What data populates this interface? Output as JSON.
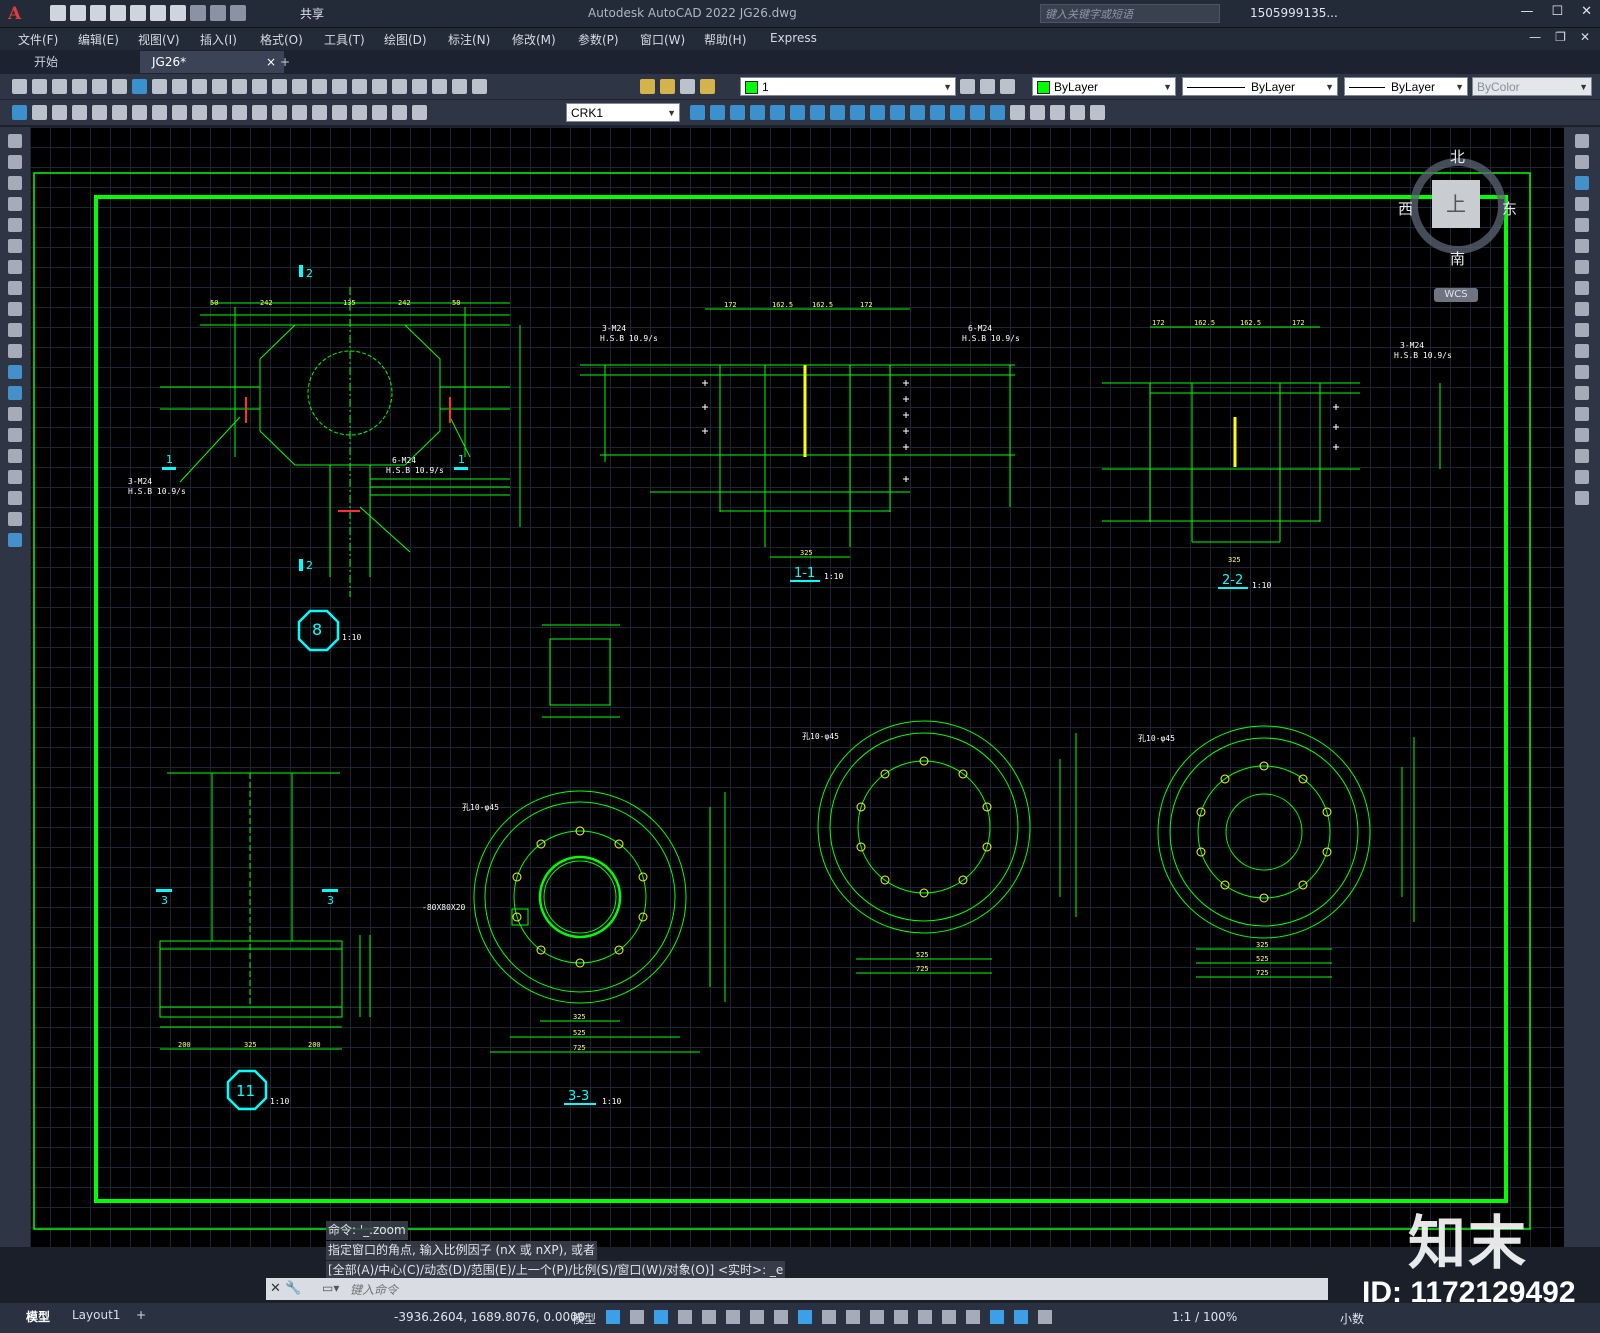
{
  "titlebar": {
    "app_icon": "A",
    "share_label": "共享",
    "title": "Autodesk AutoCAD 2022    JG26.dwg",
    "search_placeholder": "键入关键字或短语",
    "user_label": "1505999135...",
    "icons": [
      "new-icon",
      "open-icon",
      "save-icon",
      "saveas-icon",
      "plot-icon",
      "undo-icon",
      "redo-icon",
      "cart-icon",
      "help-icon"
    ]
  },
  "menu": {
    "items": [
      "文件(F)",
      "编辑(E)",
      "视图(V)",
      "插入(I)",
      "格式(O)",
      "工具(T)",
      "绘图(D)",
      "标注(N)",
      "修改(M)",
      "参数(P)",
      "窗口(W)",
      "帮助(H)",
      "Express"
    ]
  },
  "tabs": {
    "start": "开始",
    "file": "JG26*",
    "close_glyph": "×",
    "add_glyph": "+"
  },
  "toolbar": {
    "layer_value": "1",
    "color_value": "ByLayer",
    "linetype_value": "ByLayer",
    "lineweight_value": "ByLayer",
    "plotstyle_value": "ByColor",
    "dimstyle_value": "CRK1"
  },
  "viewcube": {
    "north": "北",
    "south": "南",
    "east": "东",
    "west": "西",
    "face": "上",
    "ucs_label": "WCS"
  },
  "drawing": {
    "callouts": [
      {
        "label": "8",
        "scale": "1:10"
      },
      {
        "label": "11",
        "scale": "1:10"
      }
    ],
    "sections": [
      {
        "label": "1-1",
        "scale": "1:10"
      },
      {
        "label": "2-2",
        "scale": "1:10"
      },
      {
        "label": "3-3",
        "scale": "1:10"
      }
    ],
    "bolt_notes": [
      "3-M24",
      "H.S.B 10.9/s",
      "6-M24",
      "H.S.B 10.9/s"
    ],
    "plate_note": "-80X80X20",
    "hole_notes": [
      "孔10-φ45",
      "孔10-φ45",
      "孔10-φ45"
    ],
    "dims_top": [
      "50",
      "242",
      "135",
      "242",
      "50"
    ],
    "dims_section": [
      "172",
      "162.5",
      "162.5",
      "172"
    ],
    "dims_bottom": [
      "325",
      "525",
      "725"
    ],
    "base_dims": [
      "200",
      "325",
      "200"
    ],
    "section_marks": [
      "1",
      "1",
      "2",
      "2",
      "3",
      "3"
    ]
  },
  "command": {
    "history": [
      "命令: '_.zoom",
      "指定窗口的角点, 输入比例因子 (nX 或 nXP), 或者",
      "[全部(A)/中心(C)/动态(D)/范围(E)/上一个(P)/比例(S)/窗口(W)/对象(O)] <实时>: _e"
    ],
    "placeholder": "键入命令"
  },
  "status": {
    "model_tab": "模型",
    "layout_tab": "Layout1",
    "add_glyph": "+",
    "coordinates": "-3936.2604, 1689.8076, 0.0000",
    "space": "模型",
    "scale": "1:1 / 100%",
    "units": "小数"
  },
  "watermark": {
    "logo": "知末",
    "id": "ID: 1172129492"
  },
  "colors": {
    "frame": "#00ff00",
    "geometry": "#00ff00",
    "dimension_text": "#ffff66",
    "callout": "#00ffff",
    "canvas": "#000000"
  }
}
